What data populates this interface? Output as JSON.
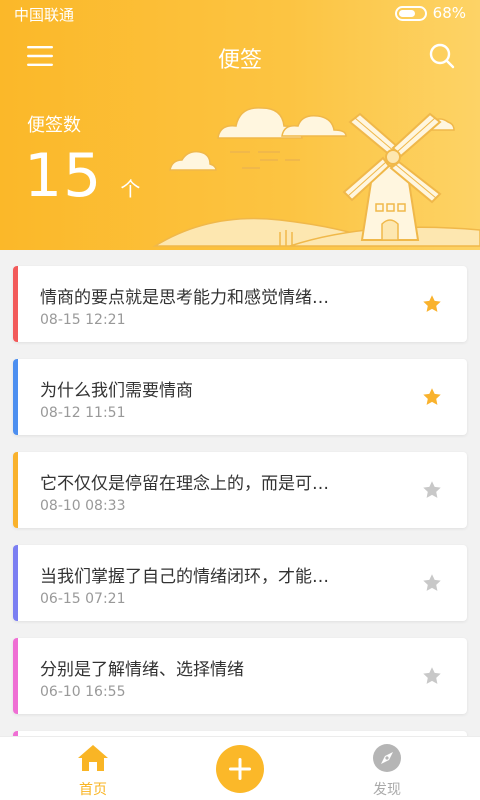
{
  "status_bar": {
    "carrier": "中国联通",
    "battery": "68%"
  },
  "navbar": {
    "title": "便签"
  },
  "summary": {
    "label": "便签数",
    "count": "15",
    "unit": "个"
  },
  "notes": [
    {
      "title": "情商的要点就是思考能力和感觉情绪…",
      "time": "08-15  12:21",
      "color": "#f25a5a",
      "starred": true
    },
    {
      "title": "为什么我们需要情商",
      "time": "08-12  11:51",
      "color": "#4d8ff0",
      "starred": true
    },
    {
      "title": "它不仅仅是停留在理念上的，而是可…",
      "time": "08-10  08:33",
      "color": "#f9b22d",
      "starred": false
    },
    {
      "title": "当我们掌握了自己的情绪闭环，才能…",
      "time": "06-15  07:21",
      "color": "#7b7ff2",
      "starred": false
    },
    {
      "title": "分别是了解情绪、选择情绪",
      "time": "06-10  16:55",
      "color": "#ef6fd4",
      "starred": false
    }
  ],
  "tabbar": {
    "home_label": "首页",
    "discover_label": "发现"
  },
  "colors": {
    "accent": "#fbb829",
    "star_on": "#f9b22d",
    "star_off": "#c8c8c8"
  }
}
